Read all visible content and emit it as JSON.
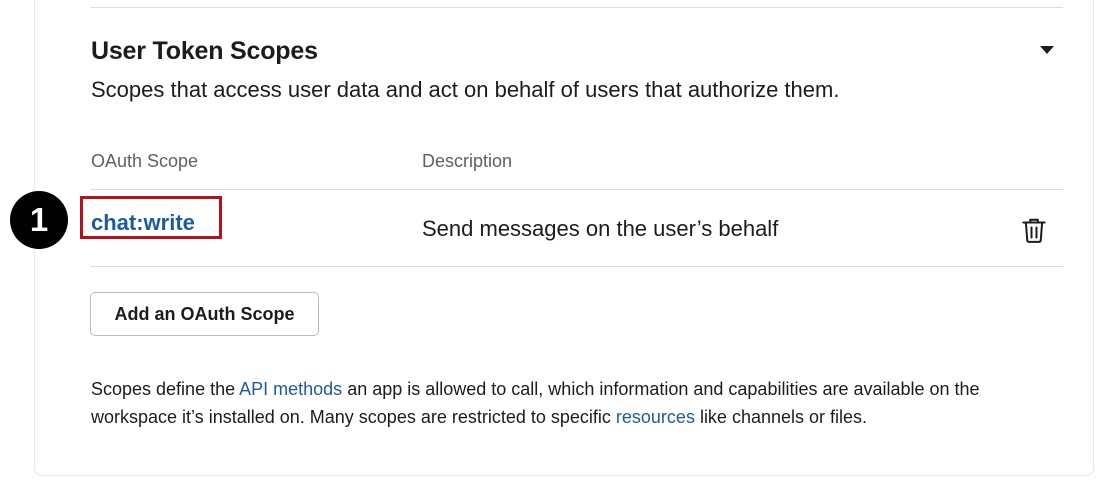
{
  "section": {
    "title": "User Token Scopes",
    "subtitle": "Scopes that access user data and act on behalf of users that authorize them."
  },
  "table": {
    "headers": [
      "OAuth Scope",
      "Description"
    ],
    "rows": [
      {
        "scope": "chat:write",
        "description": "Send messages on the user’s behalf"
      }
    ]
  },
  "callout": {
    "number": "1"
  },
  "add_button_label": "Add an OAuth Scope",
  "footer": {
    "part1": "Scopes define the ",
    "link1": "API methods",
    "part2": " an app is allowed to call, which information and capabilities are available on the workspace it’s installed on. Many scopes are restricted to specific ",
    "link2": "resources",
    "part3": " like channels or files."
  },
  "colors": {
    "link": "#1d5c9b",
    "highlight": "#b6121b",
    "text": "#1d1c1d",
    "muted": "#616061"
  },
  "icons": [
    "collapse-caret-icon",
    "trash-icon"
  ]
}
